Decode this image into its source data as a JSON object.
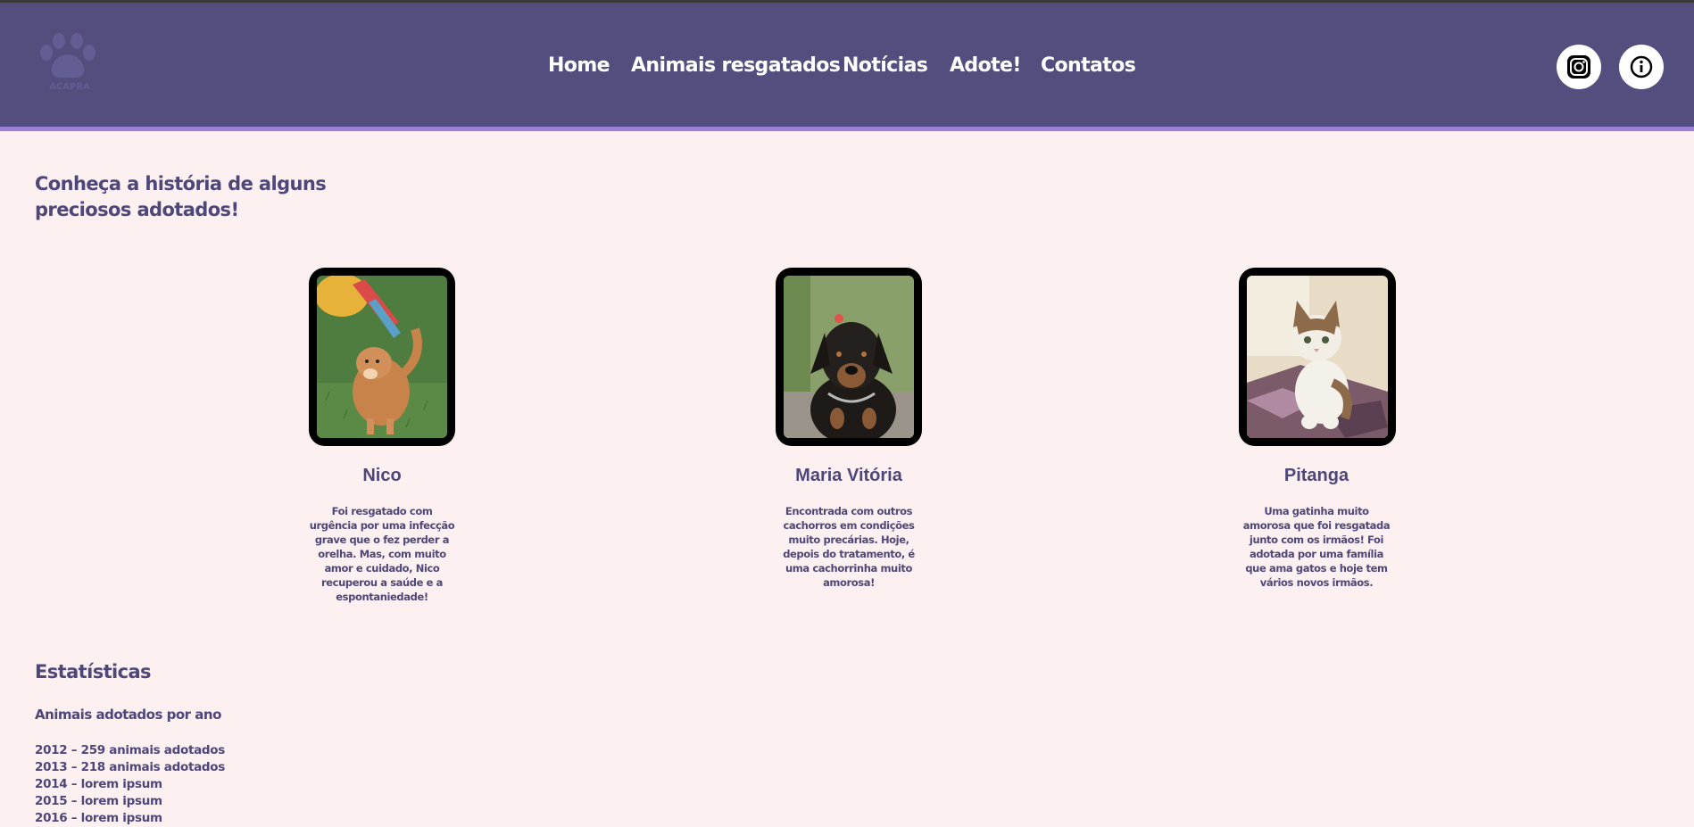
{
  "brand": {
    "logo_icon": "paw-logo-icon",
    "logo_text": "ACAPRA"
  },
  "nav": {
    "items": [
      {
        "label": "Home"
      },
      {
        "label": "Animais resgatados"
      },
      {
        "label": "Notícias"
      },
      {
        "label": "Adote!"
      },
      {
        "label": "Contatos"
      }
    ]
  },
  "social": {
    "instagram_icon": "instagram-icon",
    "info_icon": "info-icon"
  },
  "section_title": "Conheça a história de alguns preciosos adotados!",
  "pets": [
    {
      "name": "Nico",
      "description": "Foi resgatado com urgência por uma infecção grave que o fez perder a orelha. Mas, com muito amor e cuidado, Nico recuperou a saúde e a espontaniedade!"
    },
    {
      "name": "Maria Vitória",
      "description": "Encontrada com outros cachorros em condições muito precárias. Hoje, depois do tratamento, é uma cachorrinha muito amorosa!"
    },
    {
      "name": "Pitanga",
      "description": "Uma gatinha muito amorosa que foi resgatada junto com os irmãos! Foi adotada por uma família que ama gatos e hoje tem vários novos irmãos."
    }
  ],
  "stats": {
    "title": "Estatísticas",
    "subtitle": "Animais adotados por ano",
    "items": [
      "2012 – 259 animais adotados",
      "2013 – 218 animais adotados",
      "2014 – lorem ipsum",
      "2015 – lorem ipsum",
      "2016 – lorem ipsum"
    ]
  },
  "colors": {
    "header_bg": "#534e7e",
    "header_accent": "#9b82d4",
    "page_bg": "#fdf0f1",
    "text": "#4d477a"
  }
}
